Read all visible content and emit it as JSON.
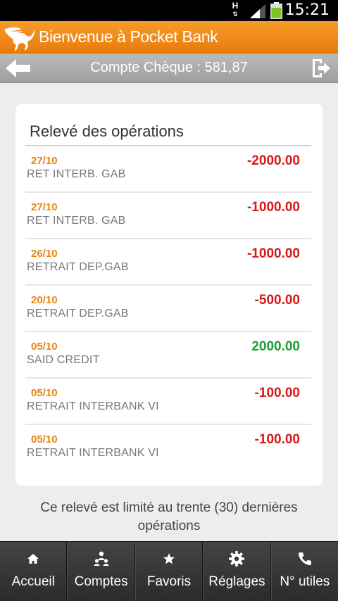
{
  "status_bar": {
    "time": "15:21",
    "network_type": "H"
  },
  "app": {
    "title": "Bienvenue à Pocket Bank"
  },
  "nav": {
    "account_title": "Compte Chèque : 581,87"
  },
  "statement": {
    "heading": "Relevé des opérations",
    "operations": [
      {
        "date": "27/10",
        "label": "RET INTERB. GAB",
        "amount": "-2000.00",
        "kind": "debit"
      },
      {
        "date": "27/10",
        "label": "RET INTERB. GAB",
        "amount": "-1000.00",
        "kind": "debit"
      },
      {
        "date": "26/10",
        "label": "RETRAIT DEP.GAB",
        "amount": "-1000.00",
        "kind": "debit"
      },
      {
        "date": "20/10",
        "label": "RETRAIT DEP.GAB",
        "amount": "-500.00",
        "kind": "debit"
      },
      {
        "date": "05/10",
        "label": "SAID CREDIT",
        "amount": "2000.00",
        "kind": "credit"
      },
      {
        "date": "05/10",
        "label": "RETRAIT INTERBANK VI",
        "amount": "-100.00",
        "kind": "debit"
      },
      {
        "date": "05/10",
        "label": "RETRAIT INTERBANK VI",
        "amount": "-100.00",
        "kind": "debit"
      }
    ],
    "notice": "Ce relevé est limité au trente (30) dernières opérations"
  },
  "tabs": [
    {
      "label": "Accueil",
      "icon": "home-icon"
    },
    {
      "label": "Comptes",
      "icon": "accounts-icon"
    },
    {
      "label": "Favoris",
      "icon": "star-icon"
    },
    {
      "label": "Réglages",
      "icon": "gear-icon"
    },
    {
      "label": "N° utiles",
      "icon": "phone-icon"
    }
  ],
  "colors": {
    "brand_orange": "#ef8a14",
    "date_orange": "#e8850f",
    "debit_red": "#d71a1a",
    "credit_green": "#1e9e33"
  }
}
